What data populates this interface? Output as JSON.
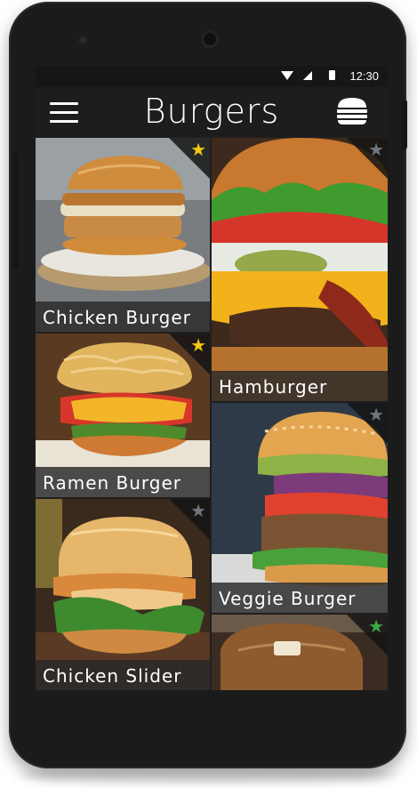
{
  "status_bar": {
    "time": "12:30"
  },
  "app_bar": {
    "title": "Burgers"
  },
  "items": [
    {
      "label": "Chicken Burger",
      "favorite": true
    },
    {
      "label": "Hamburger",
      "favorite": false
    },
    {
      "label": "Ramen Burger",
      "favorite": true
    },
    {
      "label": "Veggie Burger",
      "favorite": false
    },
    {
      "label": "Chicken Slider",
      "favorite": false
    },
    {
      "label": "",
      "favorite": false
    }
  ],
  "colors": {
    "favorite_star": "#f2c811",
    "unfavorite_star": "#6f7681",
    "background": "#1f1f1f"
  }
}
